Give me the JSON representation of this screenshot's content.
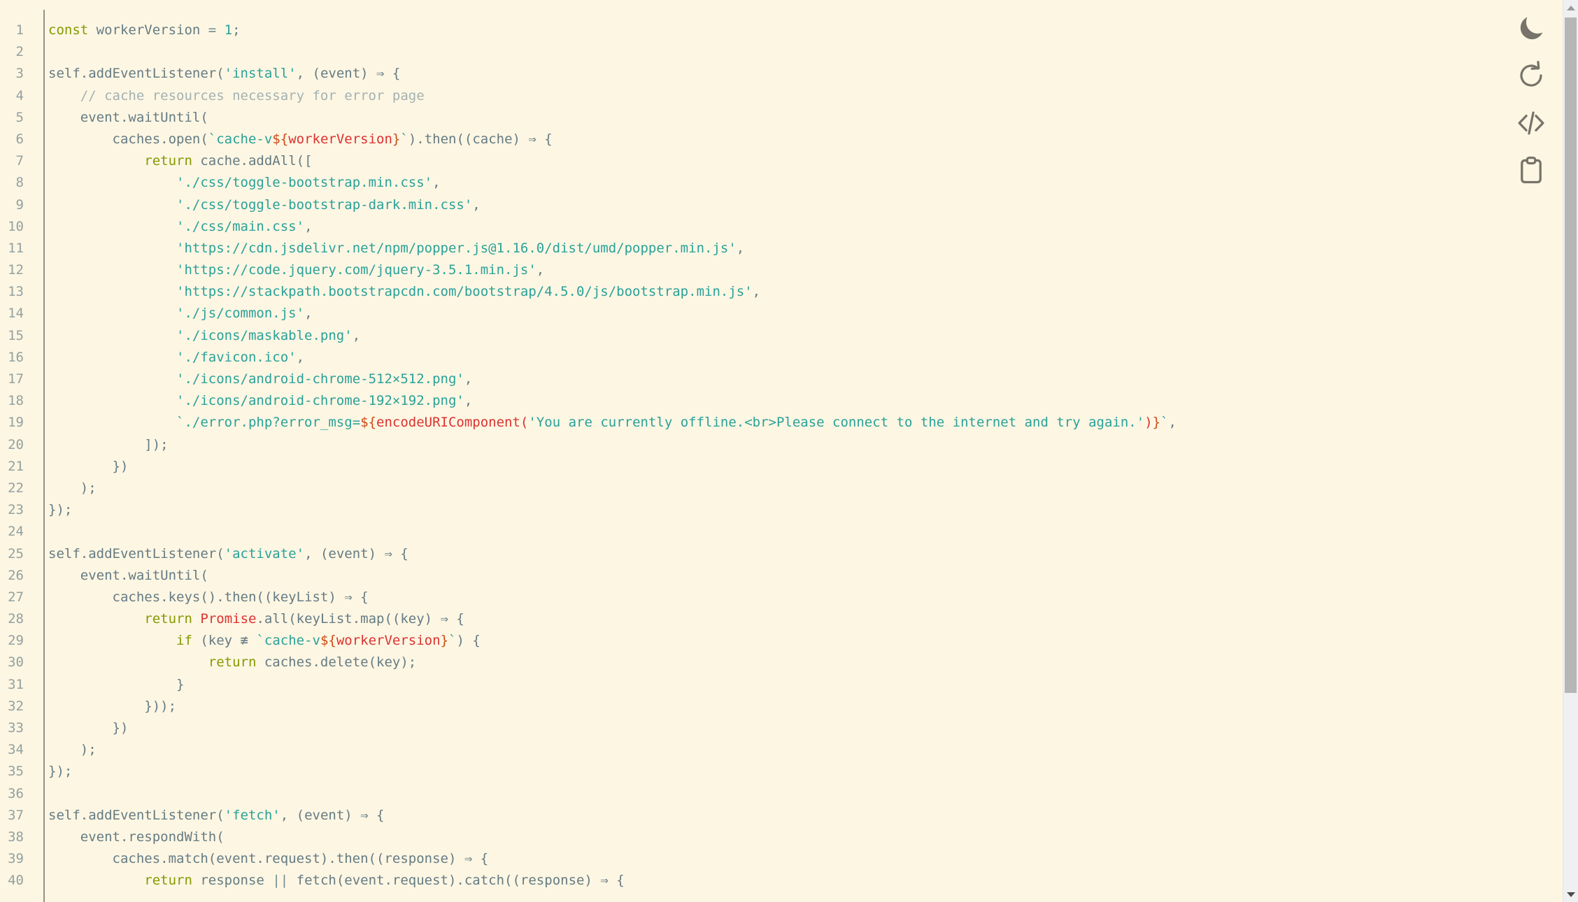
{
  "editor": {
    "language": "javascript",
    "filename_hint": "service-worker.js",
    "first_visible_line": 1,
    "last_visible_line": 40,
    "total_visible_lines": 40,
    "background_color": "#fdf6e3",
    "text_color": "#657b83",
    "gutter_color": "#93a1a1",
    "font_size_px": 19,
    "line_height_px": 31.2
  },
  "toolbar": {
    "buttons": [
      {
        "name": "dark-mode-toggle",
        "icon": "moon-icon",
        "label": "Toggle dark mode"
      },
      {
        "name": "reload-button",
        "icon": "refresh-icon",
        "label": "Reload"
      },
      {
        "name": "view-source-button",
        "icon": "code-icon",
        "label": "View source"
      },
      {
        "name": "copy-button",
        "icon": "clipboard-icon",
        "label": "Copy to clipboard"
      }
    ],
    "icon_color": "#77736a"
  },
  "scrollbar": {
    "up_arrow": "▲",
    "down_arrow": "▼",
    "thumb_top_pct": 1.9,
    "thumb_height_pct": 74.9,
    "track_color": "#eff0f1",
    "thumb_color": "#b6b6b6"
  },
  "palette": {
    "keyword": "#859900",
    "string": "#2aa198",
    "template_delim": "#cb4b16",
    "template_var": "#dc322f",
    "class_name": "#dc322f",
    "comment": "#a3b2b2",
    "plain": "#657b83"
  },
  "code": {
    "lines": [
      {
        "n": 1,
        "tokens": [
          {
            "t": "const",
            "c": "t-kw"
          },
          {
            "t": " workerVersion ",
            "c": "t-plain"
          },
          {
            "t": "=",
            "c": "t-op"
          },
          {
            "t": " ",
            "c": "t-plain"
          },
          {
            "t": "1",
            "c": "t-str"
          },
          {
            "t": ";",
            "c": "t-plain"
          }
        ]
      },
      {
        "n": 2,
        "tokens": []
      },
      {
        "n": 3,
        "tokens": [
          {
            "t": "self.addEventListener(",
            "c": "t-plain"
          },
          {
            "t": "'install'",
            "c": "t-str"
          },
          {
            "t": ", (event) ⇒ {",
            "c": "t-plain"
          }
        ]
      },
      {
        "n": 4,
        "tokens": [
          {
            "t": "    // cache resources necessary for error page",
            "c": "t-com"
          }
        ]
      },
      {
        "n": 5,
        "tokens": [
          {
            "t": "    event.waitUntil(",
            "c": "t-plain"
          }
        ]
      },
      {
        "n": 6,
        "tokens": [
          {
            "t": "        caches.open(",
            "c": "t-plain"
          },
          {
            "t": "`cache-v",
            "c": "t-str"
          },
          {
            "t": "${",
            "c": "t-tmpl"
          },
          {
            "t": "workerVersion",
            "c": "t-tmplvar"
          },
          {
            "t": "}",
            "c": "t-tmpl"
          },
          {
            "t": "`",
            "c": "t-str"
          },
          {
            "t": ").then((cache) ⇒ {",
            "c": "t-plain"
          }
        ]
      },
      {
        "n": 7,
        "tokens": [
          {
            "t": "            ",
            "c": "t-plain"
          },
          {
            "t": "return",
            "c": "t-kw"
          },
          {
            "t": " cache.addAll([",
            "c": "t-plain"
          }
        ]
      },
      {
        "n": 8,
        "tokens": [
          {
            "t": "                ",
            "c": "t-plain"
          },
          {
            "t": "'./css/toggle-bootstrap.min.css'",
            "c": "t-str"
          },
          {
            "t": ",",
            "c": "t-plain"
          }
        ]
      },
      {
        "n": 9,
        "tokens": [
          {
            "t": "                ",
            "c": "t-plain"
          },
          {
            "t": "'./css/toggle-bootstrap-dark.min.css'",
            "c": "t-str"
          },
          {
            "t": ",",
            "c": "t-plain"
          }
        ]
      },
      {
        "n": 10,
        "tokens": [
          {
            "t": "                ",
            "c": "t-plain"
          },
          {
            "t": "'./css/main.css'",
            "c": "t-str"
          },
          {
            "t": ",",
            "c": "t-plain"
          }
        ]
      },
      {
        "n": 11,
        "tokens": [
          {
            "t": "                ",
            "c": "t-plain"
          },
          {
            "t": "'https://cdn.jsdelivr.net/npm/popper.js@1.16.0/dist/umd/popper.min.js'",
            "c": "t-str"
          },
          {
            "t": ",",
            "c": "t-plain"
          }
        ]
      },
      {
        "n": 12,
        "tokens": [
          {
            "t": "                ",
            "c": "t-plain"
          },
          {
            "t": "'https://code.jquery.com/jquery-3.5.1.min.js'",
            "c": "t-str"
          },
          {
            "t": ",",
            "c": "t-plain"
          }
        ]
      },
      {
        "n": 13,
        "tokens": [
          {
            "t": "                ",
            "c": "t-plain"
          },
          {
            "t": "'https://stackpath.bootstrapcdn.com/bootstrap/4.5.0/js/bootstrap.min.js'",
            "c": "t-str"
          },
          {
            "t": ",",
            "c": "t-plain"
          }
        ]
      },
      {
        "n": 14,
        "tokens": [
          {
            "t": "                ",
            "c": "t-plain"
          },
          {
            "t": "'./js/common.js'",
            "c": "t-str"
          },
          {
            "t": ",",
            "c": "t-plain"
          }
        ]
      },
      {
        "n": 15,
        "tokens": [
          {
            "t": "                ",
            "c": "t-plain"
          },
          {
            "t": "'./icons/maskable.png'",
            "c": "t-str"
          },
          {
            "t": ",",
            "c": "t-plain"
          }
        ]
      },
      {
        "n": 16,
        "tokens": [
          {
            "t": "                ",
            "c": "t-plain"
          },
          {
            "t": "'./favicon.ico'",
            "c": "t-str"
          },
          {
            "t": ",",
            "c": "t-plain"
          }
        ]
      },
      {
        "n": 17,
        "tokens": [
          {
            "t": "                ",
            "c": "t-plain"
          },
          {
            "t": "'./icons/android-chrome-512×512.png'",
            "c": "t-str"
          },
          {
            "t": ",",
            "c": "t-plain"
          }
        ]
      },
      {
        "n": 18,
        "tokens": [
          {
            "t": "                ",
            "c": "t-plain"
          },
          {
            "t": "'./icons/android-chrome-192×192.png'",
            "c": "t-str"
          },
          {
            "t": ",",
            "c": "t-plain"
          }
        ]
      },
      {
        "n": 19,
        "tokens": [
          {
            "t": "                ",
            "c": "t-plain"
          },
          {
            "t": "`./error.php?error_msg=",
            "c": "t-str"
          },
          {
            "t": "${",
            "c": "t-tmpl"
          },
          {
            "t": "encodeURIComponent(",
            "c": "t-tmplvar"
          },
          {
            "t": "'You are currently offline.<br>Please connect to the internet and try again.'",
            "c": "t-str"
          },
          {
            "t": ")",
            "c": "t-tmplvar"
          },
          {
            "t": "}",
            "c": "t-tmpl"
          },
          {
            "t": "`",
            "c": "t-str"
          },
          {
            "t": ",",
            "c": "t-plain"
          }
        ]
      },
      {
        "n": 20,
        "tokens": [
          {
            "t": "            ]);",
            "c": "t-plain"
          }
        ]
      },
      {
        "n": 21,
        "tokens": [
          {
            "t": "        })",
            "c": "t-plain"
          }
        ]
      },
      {
        "n": 22,
        "tokens": [
          {
            "t": "    );",
            "c": "t-plain"
          }
        ]
      },
      {
        "n": 23,
        "tokens": [
          {
            "t": "});",
            "c": "t-plain"
          }
        ]
      },
      {
        "n": 24,
        "tokens": []
      },
      {
        "n": 25,
        "tokens": [
          {
            "t": "self.addEventListener(",
            "c": "t-plain"
          },
          {
            "t": "'activate'",
            "c": "t-str"
          },
          {
            "t": ", (event) ⇒ {",
            "c": "t-plain"
          }
        ]
      },
      {
        "n": 26,
        "tokens": [
          {
            "t": "    event.waitUntil(",
            "c": "t-plain"
          }
        ]
      },
      {
        "n": 27,
        "tokens": [
          {
            "t": "        caches.keys().then((keyList) ⇒ {",
            "c": "t-plain"
          }
        ]
      },
      {
        "n": 28,
        "tokens": [
          {
            "t": "            ",
            "c": "t-plain"
          },
          {
            "t": "return",
            "c": "t-kw"
          },
          {
            "t": " ",
            "c": "t-plain"
          },
          {
            "t": "Promise",
            "c": "t-cls"
          },
          {
            "t": ".all(keyList.map((key) ⇒ {",
            "c": "t-plain"
          }
        ]
      },
      {
        "n": 29,
        "tokens": [
          {
            "t": "                ",
            "c": "t-plain"
          },
          {
            "t": "if",
            "c": "t-kw"
          },
          {
            "t": " (key ≢ ",
            "c": "t-plain"
          },
          {
            "t": "`cache-v",
            "c": "t-str"
          },
          {
            "t": "${",
            "c": "t-tmpl"
          },
          {
            "t": "workerVersion",
            "c": "t-tmplvar"
          },
          {
            "t": "}",
            "c": "t-tmpl"
          },
          {
            "t": "`",
            "c": "t-str"
          },
          {
            "t": ") {",
            "c": "t-plain"
          }
        ]
      },
      {
        "n": 30,
        "tokens": [
          {
            "t": "                    ",
            "c": "t-plain"
          },
          {
            "t": "return",
            "c": "t-kw"
          },
          {
            "t": " caches.delete(key);",
            "c": "t-plain"
          }
        ]
      },
      {
        "n": 31,
        "tokens": [
          {
            "t": "                }",
            "c": "t-plain"
          }
        ]
      },
      {
        "n": 32,
        "tokens": [
          {
            "t": "            }));",
            "c": "t-plain"
          }
        ]
      },
      {
        "n": 33,
        "tokens": [
          {
            "t": "        })",
            "c": "t-plain"
          }
        ]
      },
      {
        "n": 34,
        "tokens": [
          {
            "t": "    );",
            "c": "t-plain"
          }
        ]
      },
      {
        "n": 35,
        "tokens": [
          {
            "t": "});",
            "c": "t-plain"
          }
        ]
      },
      {
        "n": 36,
        "tokens": []
      },
      {
        "n": 37,
        "tokens": [
          {
            "t": "self.addEventListener(",
            "c": "t-plain"
          },
          {
            "t": "'fetch'",
            "c": "t-str"
          },
          {
            "t": ", (event) ⇒ {",
            "c": "t-plain"
          }
        ]
      },
      {
        "n": 38,
        "tokens": [
          {
            "t": "    event.respondWith(",
            "c": "t-plain"
          }
        ]
      },
      {
        "n": 39,
        "tokens": [
          {
            "t": "        caches.match(event.request).then((response) ⇒ {",
            "c": "t-plain"
          }
        ]
      },
      {
        "n": 40,
        "tokens": [
          {
            "t": "            ",
            "c": "t-plain"
          },
          {
            "t": "return",
            "c": "t-kw"
          },
          {
            "t": " response ",
            "c": "t-plain"
          },
          {
            "t": "||",
            "c": "t-op"
          },
          {
            "t": " fetch(event.request).catch((response) ⇒ {",
            "c": "t-plain"
          }
        ]
      }
    ]
  }
}
